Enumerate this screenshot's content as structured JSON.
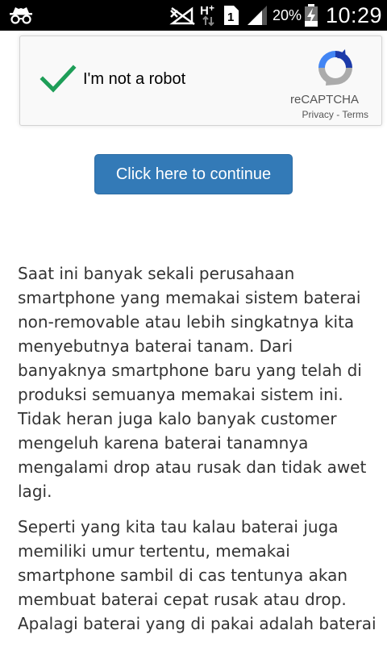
{
  "status_bar": {
    "icons": [
      "incognito-icon",
      "no-sim-icon",
      "h-plus-data-icon",
      "sim-1-icon",
      "signal-icon",
      "battery-charging-icon"
    ],
    "battery_percent": "20%",
    "time": "10:29"
  },
  "recaptcha": {
    "checkbox_state": "checked",
    "label": "I'm not a robot",
    "brand": "reCAPTCHA",
    "privacy_link": "Privacy",
    "separator": " - ",
    "terms_link": "Terms",
    "colors": {
      "check": "#1e9e58",
      "logo_blue": "#1c3aa9",
      "logo_light_blue": "#4285f4",
      "logo_gray": "#ababab"
    }
  },
  "continue_button": {
    "label": "Click here to continue",
    "color": "#337ab7"
  },
  "article": {
    "paragraph_1_lines": [
      "Saat ini banyak sekali perusahaan",
      "smartphone yang memakai sistem baterai",
      "non-removable atau lebih singkatnya kita",
      "menyebutnya baterai tanam. Dari",
      "banyaknya smartphone baru yang telah di",
      "produksi semuanya memakai sistem ini.",
      "Tidak heran juga kalo banyak customer",
      "mengeluh karena baterai tanamnya",
      "mengalami drop atau rusak dan tidak awet",
      "lagi."
    ],
    "paragraph_2_lines": [
      "Seperti yang kita tau kalau baterai juga",
      "memiliki umur tertentu, memakai",
      "smartphone sambil di cas tentunya akan",
      "membuat baterai cepat rusak atau drop.",
      "Apalagi baterai yang di pakai adalah baterai"
    ]
  }
}
